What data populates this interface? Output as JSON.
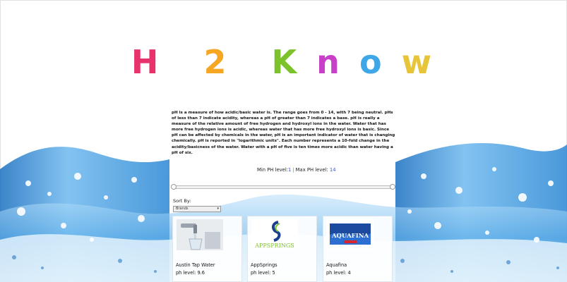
{
  "logo": {
    "letters": [
      {
        "char": "H",
        "color": "#e8326b"
      },
      {
        "char": "2",
        "color": "#f5a623"
      },
      {
        "char": "K",
        "color": "#7cc22b"
      },
      {
        "char": "n",
        "color": "#c83fc8"
      },
      {
        "char": "o",
        "color": "#3fa7e8"
      },
      {
        "char": "w",
        "color": "#e8c43a"
      }
    ]
  },
  "description": "pH is a measure of how acidic/basic water is. The range goes from 0 - 14, with 7 being neutral. pHs of less than 7 indicate acidity, whereas a pH of greater than 7 indicates a base. pH is really a measure of the relative amount of free hydrogen and hydroxyl ions in the water. Water that has more free hydrogen ions is acidic, whereas water that has more free hydroxyl ions is basic. Since pH can be affected by chemicals in the water, pH is an important indicator of water that is changing chemically. pH is reported in \"logarithmic units\". Each number represents a 10-fold change in the acidity/basicness of the water. Water with a pH of five is ten times more acidic than water having a pH of six.",
  "filters": {
    "min_label": "Min PH level:",
    "min_value": "1",
    "separator": "|",
    "max_label": "Max PH level:",
    "max_value": "14",
    "slider_min": 1,
    "slider_max": 14
  },
  "sort": {
    "label": "Sort By:",
    "selected": "Brands"
  },
  "products": [
    {
      "name": "Austin Tap Water",
      "ph": "ph level: 9.6",
      "icon": "tap-water-image"
    },
    {
      "name": "AppSprings",
      "ph": "ph level: 5",
      "icon": "appsprings-logo",
      "logo_text": "APPSPRINGS"
    },
    {
      "name": "Aquafina",
      "ph": "ph level: 4",
      "icon": "aquafina-logo",
      "logo_text": "AQUAFINA"
    }
  ],
  "colors": {
    "water_light": "#d6ecfb",
    "water_mid": "#5fb4ee",
    "water_deep": "#1674c8",
    "value_blue": "#3a56c8"
  }
}
